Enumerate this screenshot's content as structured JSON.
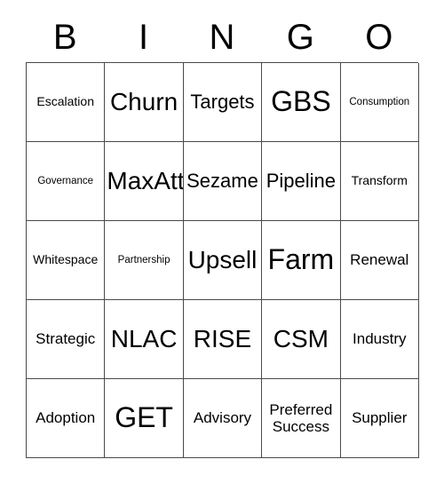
{
  "card": {
    "title": "BINGO",
    "header_letters": [
      "B",
      "I",
      "N",
      "G",
      "O"
    ],
    "columns": [
      "B",
      "I",
      "N",
      "G",
      "O"
    ],
    "size": "5x5",
    "colors": {
      "background": "#ffffff",
      "text": "#000000",
      "border": "#4a4a4a"
    },
    "rows": [
      [
        {
          "label": "Escalation",
          "size": "s"
        },
        {
          "label": "Churn",
          "size": "xl"
        },
        {
          "label": "Targets",
          "size": "l"
        },
        {
          "label": "GBS",
          "size": "xxl"
        },
        {
          "label": "Consumption",
          "size": "xs"
        }
      ],
      [
        {
          "label": "Governance",
          "size": "xs"
        },
        {
          "label": "MaxAtt",
          "size": "xl"
        },
        {
          "label": "Sezame",
          "size": "l"
        },
        {
          "label": "Pipeline",
          "size": "l"
        },
        {
          "label": "Transform",
          "size": "s"
        }
      ],
      [
        {
          "label": "Whitespace",
          "size": "s"
        },
        {
          "label": "Partnership",
          "size": "xs"
        },
        {
          "label": "Upsell",
          "size": "xl"
        },
        {
          "label": "Farm",
          "size": "xxl"
        },
        {
          "label": "Renewal",
          "size": "m"
        }
      ],
      [
        {
          "label": "Strategic",
          "size": "m"
        },
        {
          "label": "NLAC",
          "size": "xl"
        },
        {
          "label": "RISE",
          "size": "xl"
        },
        {
          "label": "CSM",
          "size": "xl"
        },
        {
          "label": "Industry",
          "size": "m"
        }
      ],
      [
        {
          "label": "Adoption",
          "size": "m"
        },
        {
          "label": "GET",
          "size": "xxl"
        },
        {
          "label": "Advisory",
          "size": "m"
        },
        {
          "label": "Preferred\nSuccess",
          "size": "m"
        },
        {
          "label": "Supplier",
          "size": "m"
        }
      ]
    ]
  }
}
